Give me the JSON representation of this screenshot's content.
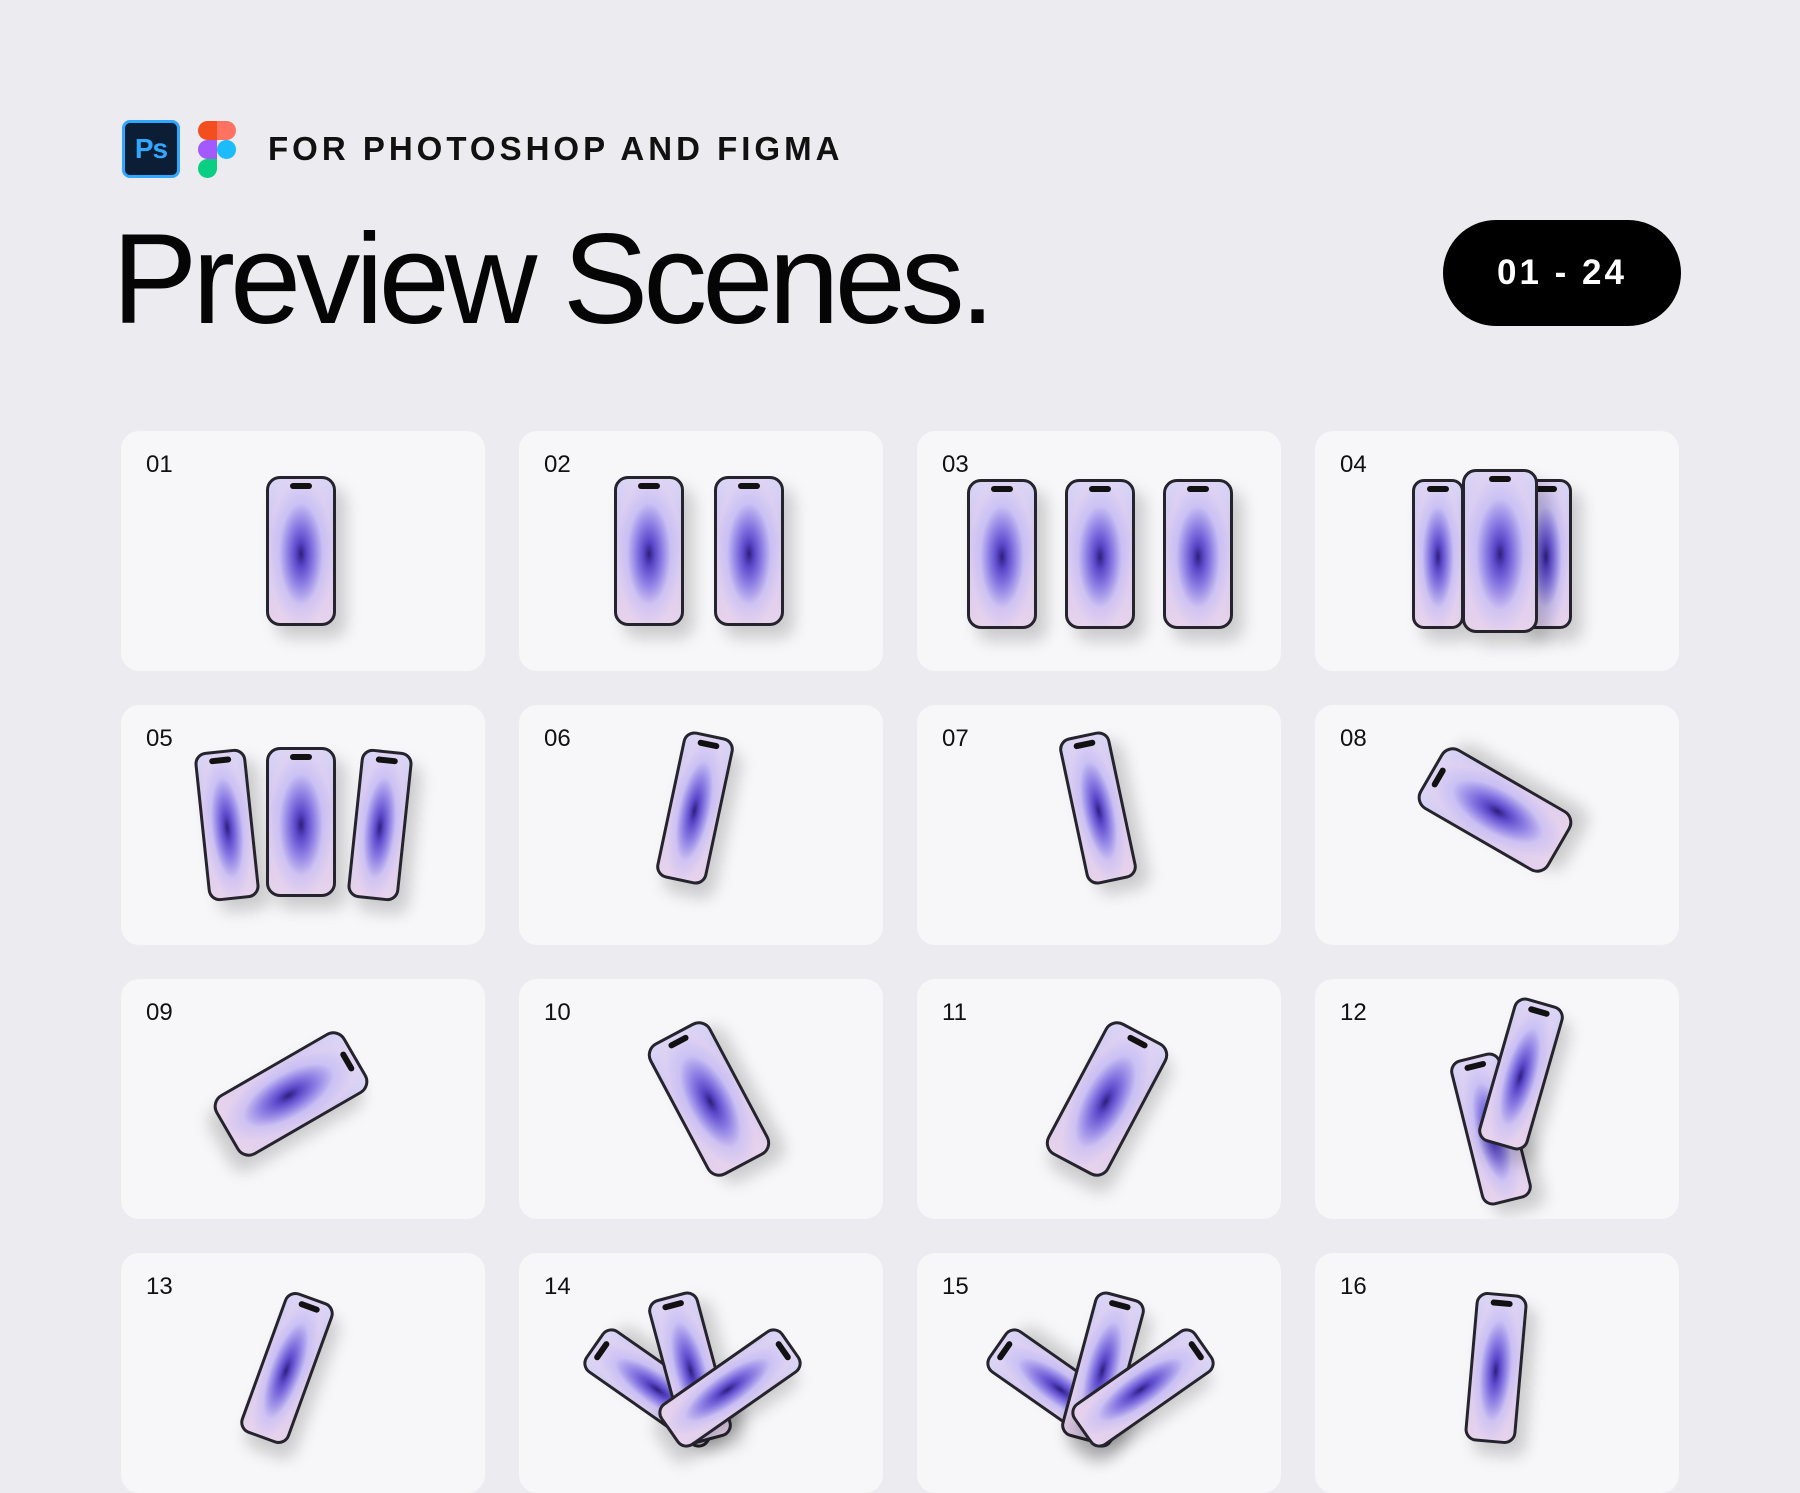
{
  "header": {
    "ps_icon_text": "Ps",
    "subtitle": "FOR PHOTOSHOP AND FIGMA",
    "title": "Preview Scenes.",
    "range": "01 - 24"
  },
  "colors": {
    "background": "#ecebef",
    "card": "#f7f7f9",
    "pill": "#000000",
    "ps_blue": "#31a8ff",
    "figma": [
      "#f24e1e",
      "#ff7262",
      "#a259ff",
      "#1abcfe",
      "#0acf83"
    ]
  },
  "scenes": [
    {
      "num": "01"
    },
    {
      "num": "02"
    },
    {
      "num": "03"
    },
    {
      "num": "04"
    },
    {
      "num": "05"
    },
    {
      "num": "06"
    },
    {
      "num": "07"
    },
    {
      "num": "08"
    },
    {
      "num": "09"
    },
    {
      "num": "10"
    },
    {
      "num": "11"
    },
    {
      "num": "12"
    },
    {
      "num": "13"
    },
    {
      "num": "14"
    },
    {
      "num": "15"
    },
    {
      "num": "16"
    }
  ]
}
